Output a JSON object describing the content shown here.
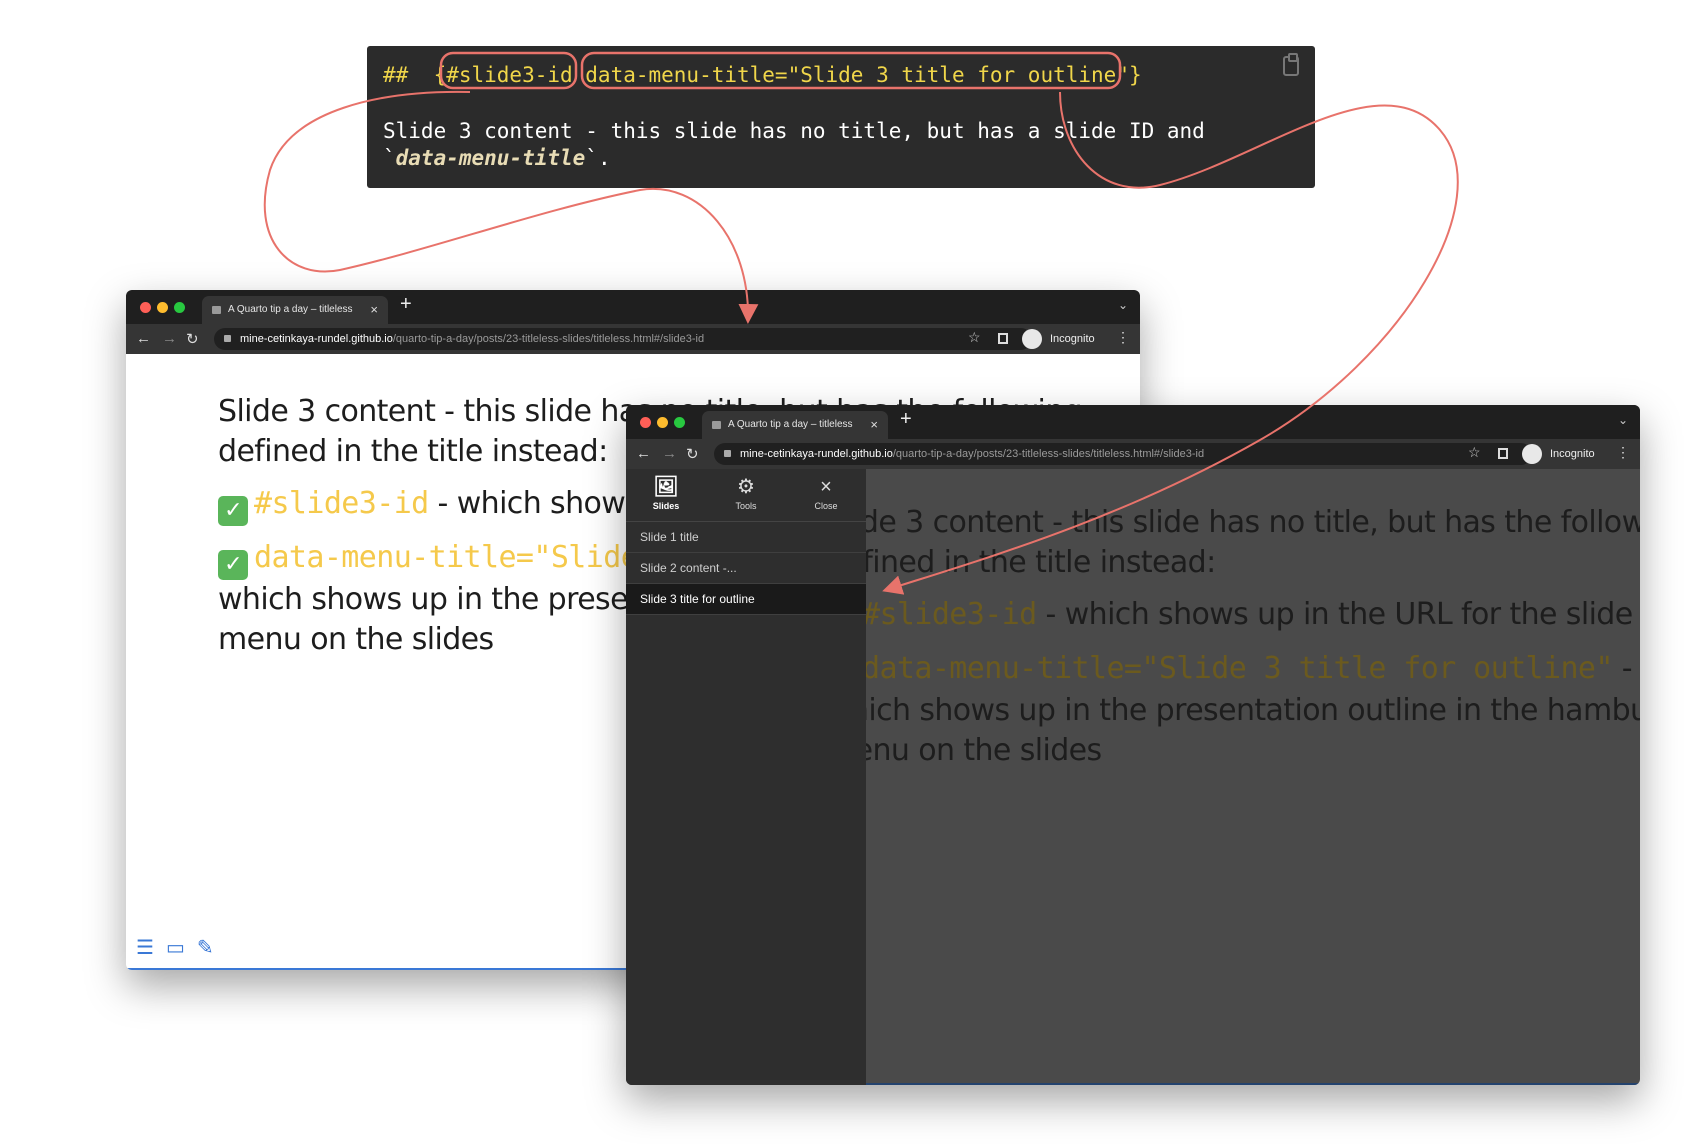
{
  "code_block": {
    "line1": "##  {#slide3-id data-menu-title=\"Slide 3 title for outline\"}",
    "line2_a": "Slide 3 content - this slide has no title, but has a slide ID and `",
    "line2_b": "data-menu-title",
    "line2_c": "`."
  },
  "browser": {
    "tab_title": "A Quarto tip a day – titleless",
    "url_host": "mine-cetinkaya-rundel.github.io",
    "url_path": "/quarto-tip-a-day/posts/23-titleless-slides/titleless.html#/slide3-id",
    "incognito": "Incognito"
  },
  "slide": {
    "p1": "Slide 3 content - this slide has no title, but has the following defined in the title instead:",
    "item1_code": "#slide3-id",
    "item1_text": " - which shows up in the URL for the slide",
    "item2_code": "data-menu-title=\"Slide 3 title for outline\"",
    "item2_text": " - which shows up in the presentation outline in the hamburger menu on the slides"
  },
  "menu": {
    "buttons": [
      "Slides",
      "Tools",
      "Close"
    ],
    "items": [
      "Slide 1 title",
      "Slide 2 content -...",
      "Slide 3 title for outline"
    ]
  },
  "colors": {
    "highlight": "#e8736b",
    "code_yellow": "#f5c94b",
    "accent": "#3a78d6"
  }
}
